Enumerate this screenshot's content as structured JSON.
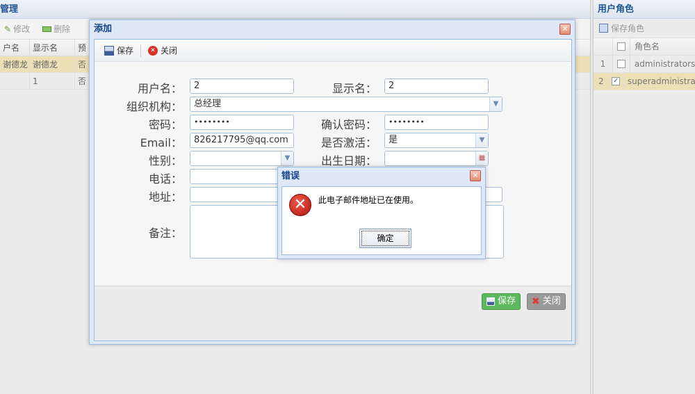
{
  "left_panel": {
    "title": "管理",
    "toolbar": {
      "edit": "修改",
      "delete": "删除"
    },
    "columns": [
      "户名",
      "显示名",
      "预"
    ],
    "rows": [
      {
        "username": "谢德龙",
        "display": "谢德龙",
        "flag": "否"
      },
      {
        "username": "",
        "display": "1",
        "flag": "否"
      }
    ]
  },
  "right_panel": {
    "title": "用户角色",
    "toolbar": {
      "save": "保存角色"
    },
    "column": "角色名",
    "rows": [
      {
        "num": "1",
        "checked": "",
        "name": "administrators"
      },
      {
        "num": "2",
        "checked": "✓",
        "name": "superadministrators"
      }
    ]
  },
  "dialog": {
    "title": "添加",
    "close_glyph": "✕",
    "toolbar": {
      "save": "保存",
      "close": "关闭"
    },
    "form": {
      "username_label": "用户名：",
      "username_value": "2",
      "display_label": "显示名：",
      "display_value": "2",
      "org_label": "组织机构：",
      "org_value": "总经理",
      "password_label": "密码：",
      "password_value": "••••••••",
      "confirm_label": "确认密码：",
      "confirm_value": "••••••••",
      "email_label": "Email：",
      "email_value": "826217795@qq.com",
      "active_label": "是否激活：",
      "active_value": "是",
      "gender_label": "性别：",
      "gender_value": "",
      "birth_label": "出生日期：",
      "birth_value": "",
      "phone_label": "电话：",
      "phone_value": "",
      "address_label": "地址：",
      "address_value": "",
      "remark_label": "备注：",
      "remark_value": ""
    },
    "footer": {
      "save": "保存",
      "close": "关闭"
    }
  },
  "error": {
    "title": "错误",
    "close_glyph": "✕",
    "icon_glyph": "✕",
    "message": "此电子邮件地址已在使用。",
    "ok": "确定"
  },
  "colors": {
    "save_green": "#5cb85c",
    "close_gray": "#9a9a9a",
    "dialog_border": "#99bbe8",
    "title_blue": "#15428b"
  }
}
